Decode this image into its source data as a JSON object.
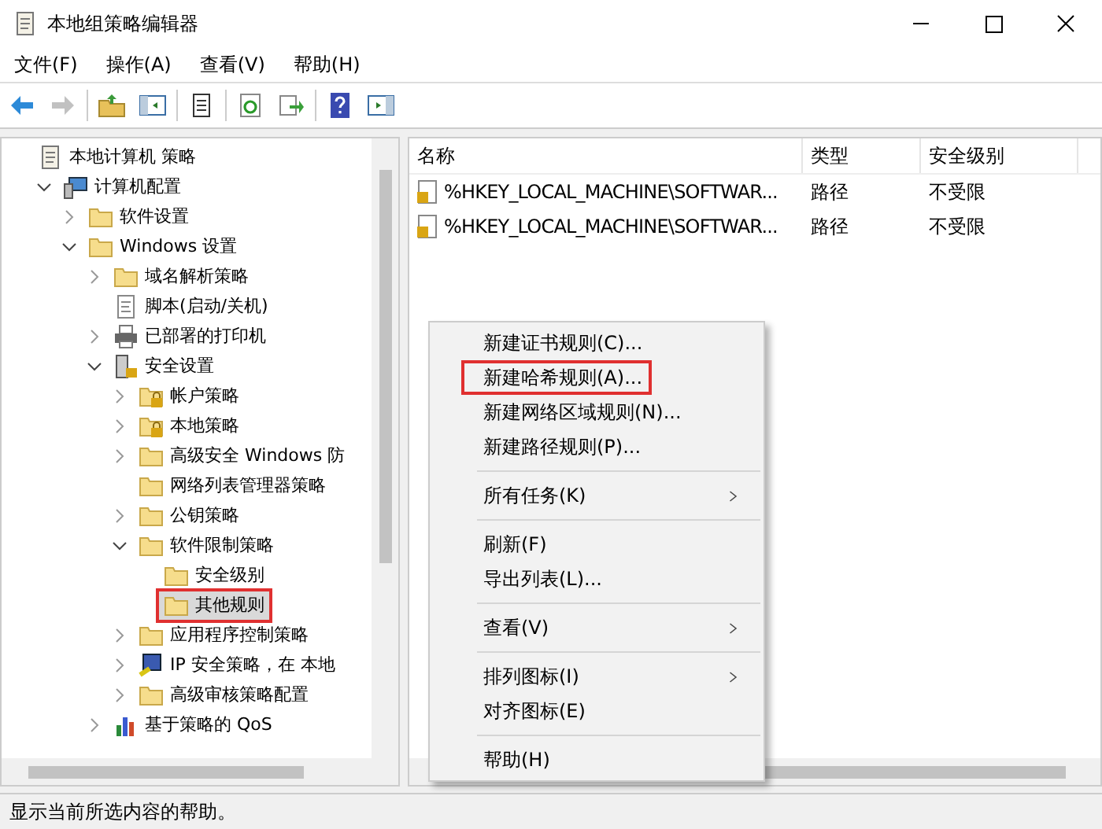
{
  "window": {
    "title": "本地组策略编辑器"
  },
  "menu_bar": [
    "文件(F)",
    "操作(A)",
    "查看(V)",
    "帮助(H)"
  ],
  "toolbar": [
    {
      "kind": "back",
      "disabled": false
    },
    {
      "kind": "forward",
      "disabled": true
    },
    {
      "kind": "sep"
    },
    {
      "kind": "up",
      "disabled": false
    },
    {
      "kind": "tree",
      "disabled": false
    },
    {
      "kind": "sep"
    },
    {
      "kind": "properties",
      "disabled": false
    },
    {
      "kind": "sep"
    },
    {
      "kind": "refresh",
      "disabled": false
    },
    {
      "kind": "export",
      "disabled": false
    },
    {
      "kind": "sep"
    },
    {
      "kind": "help",
      "disabled": false
    },
    {
      "kind": "pane",
      "disabled": false
    }
  ],
  "tree": [
    {
      "label": "本地计算机 策略",
      "kind": "policy",
      "selected": false,
      "highlighted": false,
      "children": [
        {
          "label": "计算机配置",
          "kind": "computer",
          "expanded": true,
          "selected": false,
          "highlighted": false,
          "children": [
            {
              "label": "软件设置",
              "kind": "folder",
              "expanded": false,
              "selected": false,
              "highlighted": false
            },
            {
              "label": "Windows 设置",
              "kind": "folder",
              "expanded": true,
              "selected": false,
              "highlighted": false,
              "children": [
                {
                  "label": "域名解析策略",
                  "kind": "folder",
                  "expanded": false,
                  "selected": false,
                  "highlighted": false
                },
                {
                  "label": "脚本(启动/关机)",
                  "kind": "script",
                  "selected": false,
                  "highlighted": false
                },
                {
                  "label": "已部署的打印机",
                  "kind": "printer",
                  "expanded": false,
                  "selected": false,
                  "highlighted": false
                },
                {
                  "label": "安全设置",
                  "kind": "security",
                  "expanded": true,
                  "selected": false,
                  "highlighted": false,
                  "children": [
                    {
                      "label": "帐户策略",
                      "kind": "lockfolder",
                      "expanded": false,
                      "selected": false,
                      "highlighted": false
                    },
                    {
                      "label": "本地策略",
                      "kind": "lockfolder",
                      "expanded": false,
                      "selected": false,
                      "highlighted": false
                    },
                    {
                      "label": "高级安全 Windows 防",
                      "kind": "folder",
                      "expanded": false,
                      "selected": false,
                      "highlighted": false
                    },
                    {
                      "label": "网络列表管理器策略",
                      "kind": "folder",
                      "selected": false,
                      "highlighted": false
                    },
                    {
                      "label": "公钥策略",
                      "kind": "folder",
                      "expanded": false,
                      "selected": false,
                      "highlighted": false
                    },
                    {
                      "label": "软件限制策略",
                      "kind": "folder",
                      "expanded": true,
                      "selected": false,
                      "highlighted": false,
                      "children": [
                        {
                          "label": "安全级别",
                          "kind": "folder",
                          "selected": false,
                          "highlighted": false
                        },
                        {
                          "label": "其他规则",
                          "kind": "folder",
                          "selected": true,
                          "highlighted": true
                        }
                      ]
                    },
                    {
                      "label": "应用程序控制策略",
                      "kind": "folder",
                      "expanded": false,
                      "selected": false,
                      "highlighted": false
                    },
                    {
                      "label": "IP 安全策略，在 本地",
                      "kind": "ip",
                      "expanded": false,
                      "selected": false,
                      "highlighted": false
                    },
                    {
                      "label": "高级审核策略配置",
                      "kind": "folder",
                      "expanded": false,
                      "selected": false,
                      "highlighted": false
                    }
                  ]
                },
                {
                  "label": "基于策略的 QoS",
                  "kind": "chart",
                  "expanded": false,
                  "selected": false,
                  "highlighted": false
                }
              ]
            }
          ]
        }
      ]
    }
  ],
  "table": {
    "columns": [
      "名称",
      "类型",
      "安全级别"
    ],
    "rows": [
      [
        "%HKEY_LOCAL_MACHINE\\SOFTWAR...",
        "路径",
        "不受限"
      ],
      [
        "%HKEY_LOCAL_MACHINE\\SOFTWAR...",
        "路径",
        "不受限"
      ]
    ]
  },
  "context_menu": [
    {
      "kind": "item",
      "label": "新建证书规则(C)...",
      "submenu": false,
      "highlighted": false
    },
    {
      "kind": "item",
      "label": "新建哈希规则(A)...",
      "submenu": false,
      "highlighted": true
    },
    {
      "kind": "item",
      "label": "新建网络区域规则(N)...",
      "submenu": false,
      "highlighted": false
    },
    {
      "kind": "item",
      "label": "新建路径规则(P)...",
      "submenu": false,
      "highlighted": false
    },
    {
      "kind": "separator"
    },
    {
      "kind": "item",
      "label": "所有任务(K)",
      "submenu": true,
      "highlighted": false
    },
    {
      "kind": "separator"
    },
    {
      "kind": "item",
      "label": "刷新(F)",
      "submenu": false,
      "highlighted": false
    },
    {
      "kind": "item",
      "label": "导出列表(L)...",
      "submenu": false,
      "highlighted": false
    },
    {
      "kind": "separator"
    },
    {
      "kind": "item",
      "label": "查看(V)",
      "submenu": true,
      "highlighted": false
    },
    {
      "kind": "separator"
    },
    {
      "kind": "item",
      "label": "排列图标(I)",
      "submenu": true,
      "highlighted": false
    },
    {
      "kind": "item",
      "label": "对齐图标(E)",
      "submenu": false,
      "highlighted": false
    },
    {
      "kind": "separator"
    },
    {
      "kind": "item",
      "label": "帮助(H)",
      "submenu": false,
      "highlighted": false
    }
  ],
  "status_bar": "显示当前所选内容的帮助。"
}
